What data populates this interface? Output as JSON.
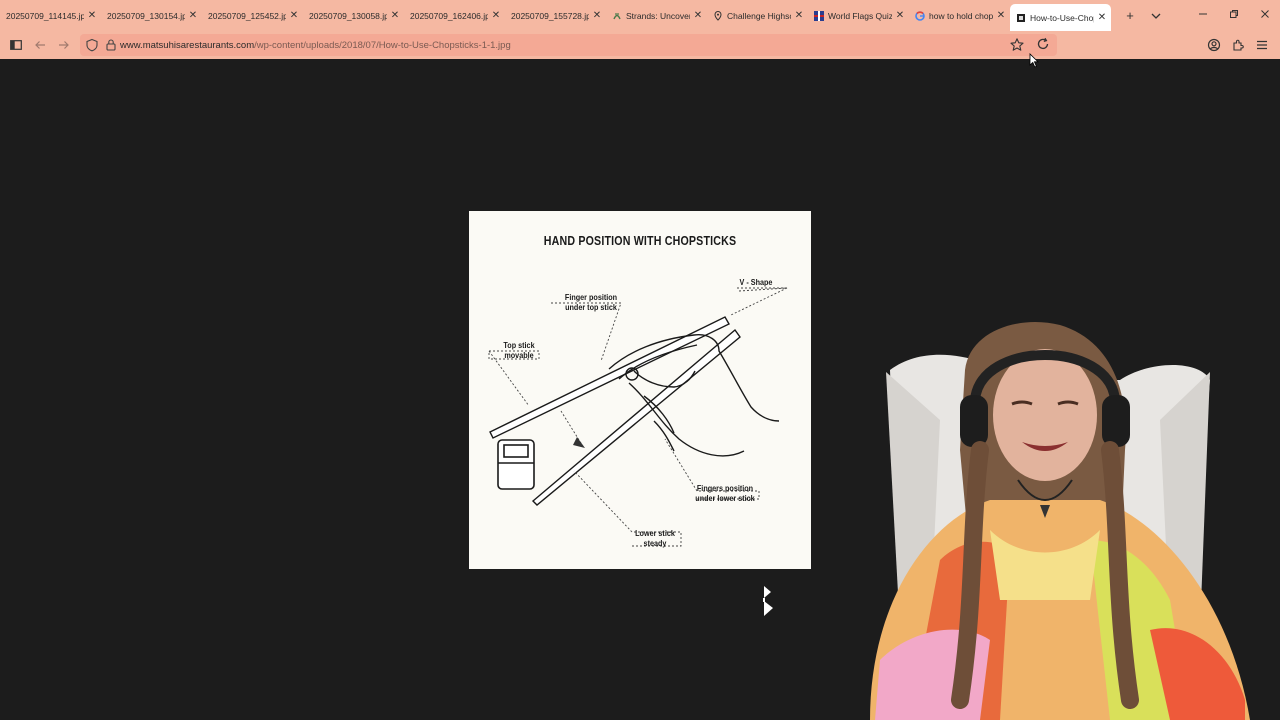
{
  "browser": {
    "tabs": [
      {
        "title": "20250709_114145.jpg",
        "icon": "image-icon"
      },
      {
        "title": "20250709_130154.jpg",
        "icon": "image-icon"
      },
      {
        "title": "20250709_125452.jpg",
        "icon": "image-icon"
      },
      {
        "title": "20250709_130058.jpg",
        "icon": "image-icon"
      },
      {
        "title": "20250709_162406.jpg",
        "icon": "image-icon"
      },
      {
        "title": "20250709_155728.jpg",
        "icon": "image-icon"
      },
      {
        "title": "Strands: Uncover",
        "icon": "strands-icon"
      },
      {
        "title": "Challenge Highsc",
        "icon": "map-pin-icon"
      },
      {
        "title": "World Flags Quiz",
        "icon": "flags-icon"
      },
      {
        "title": "how to hold chop",
        "icon": "google-icon"
      },
      {
        "title": "How-to-Use-Chop",
        "icon": "page-icon",
        "active": true
      }
    ],
    "url": {
      "host": "www.matsuhisarestaurants.com",
      "path": "/wp-content/uploads/2018/07/How-to-Use-Chopsticks-1-1.jpg"
    },
    "accent_color": "#f5b8a2"
  },
  "diagram": {
    "title": "HAND POSITION WITH CHOPSTICKS",
    "labels": {
      "v_shape": "V - Shape",
      "finger_top_1": "Finger position",
      "finger_top_2": "under top stick",
      "top_stick_1": "Top stick",
      "top_stick_2": "movable",
      "fingers_lower_1": "Fingers position",
      "fingers_lower_2": "under lower stick",
      "lower_stick_1": "Lower stick",
      "lower_stick_2": "steady"
    }
  }
}
